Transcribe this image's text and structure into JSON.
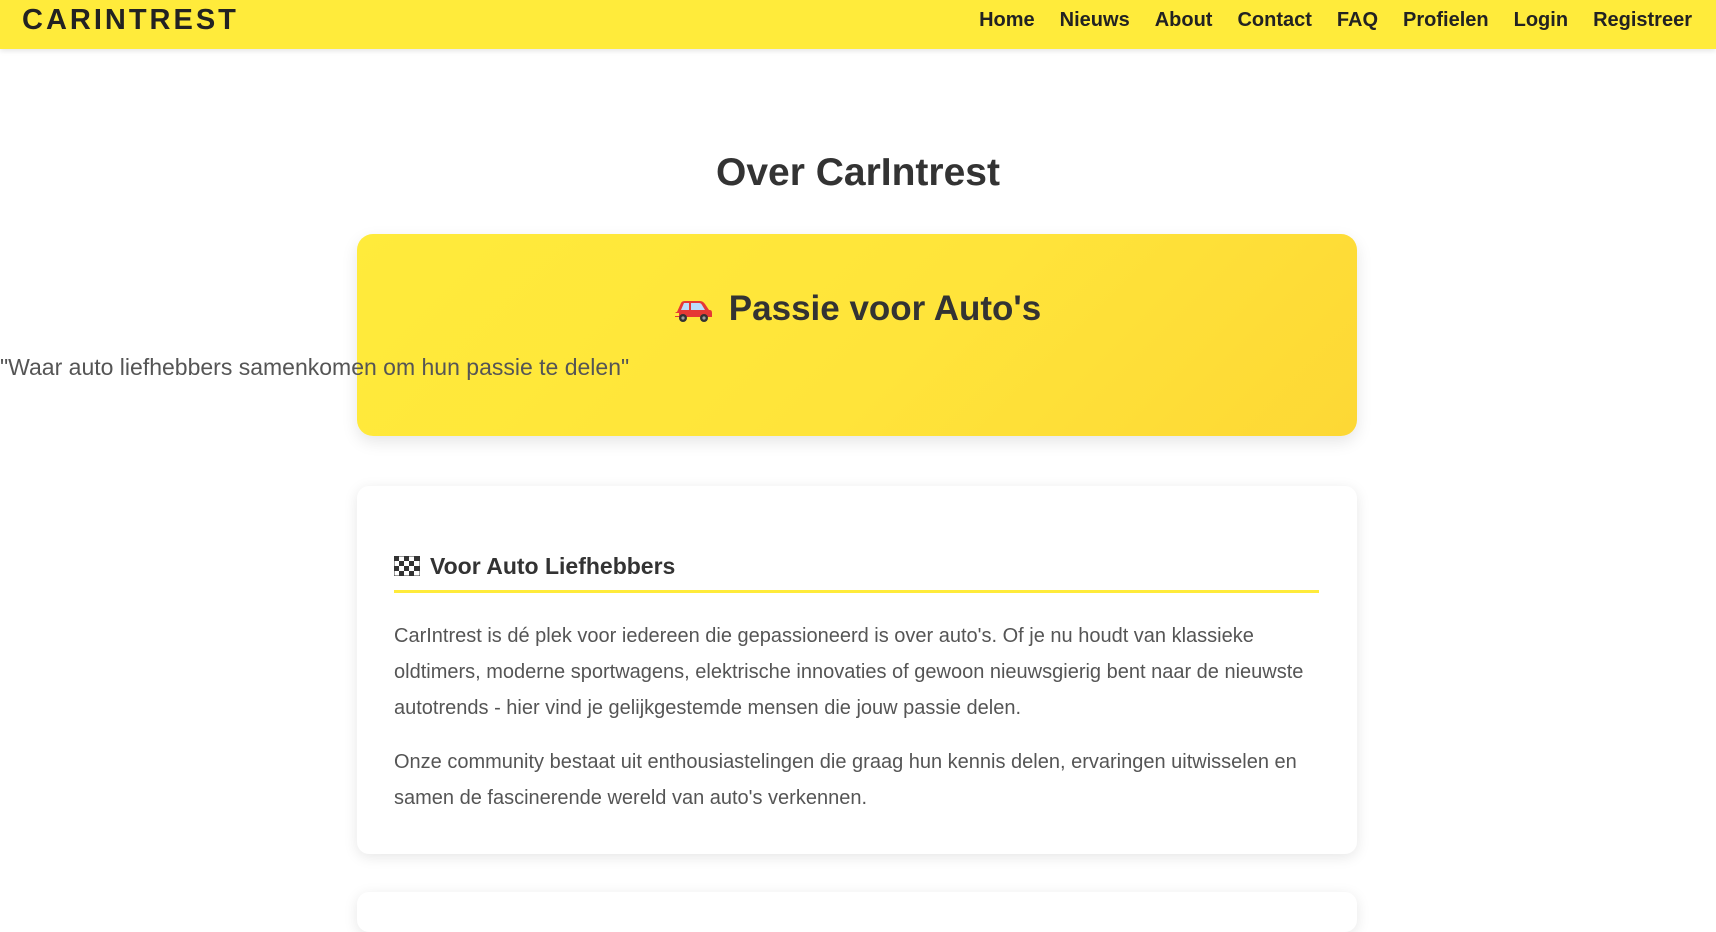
{
  "navbar": {
    "brand": "CARINTREST",
    "links": [
      "Home",
      "Nieuws",
      "About",
      "Contact",
      "FAQ",
      "Profielen",
      "Login",
      "Registreer"
    ],
    "background_color": "#ffeb3b"
  },
  "main": {
    "title": "Over CarIntrest",
    "hero": {
      "icon": "car-icon",
      "title": "Passie voor Auto's",
      "quote": "\"Waar auto liefhebbers samenkomen om hun passie te delen\""
    },
    "section": {
      "icon": "checkered-flag-icon",
      "heading": "Voor Auto Liefhebbers",
      "paragraphs": [
        "CarIntrest is dé plek voor iedereen die gepassioneerd is over auto's. Of je nu houdt van klassieke oldtimers, moderne sportwagens, elektrische innovaties of gewoon nieuwsgierig bent naar de nieuwste autotrends - hier vind je gelijkgestemde mensen die jouw passie delen.",
        "Onze community bestaat uit enthousiastelingen die graag hun kennis delen, ervaringen uitwisselen en samen de fascinerende wereld van auto's verkennen."
      ]
    }
  },
  "colors": {
    "accent": "#ffeb3b",
    "accent_dark": "#fdd835",
    "text": "#333333",
    "muted_text": "#555555"
  }
}
